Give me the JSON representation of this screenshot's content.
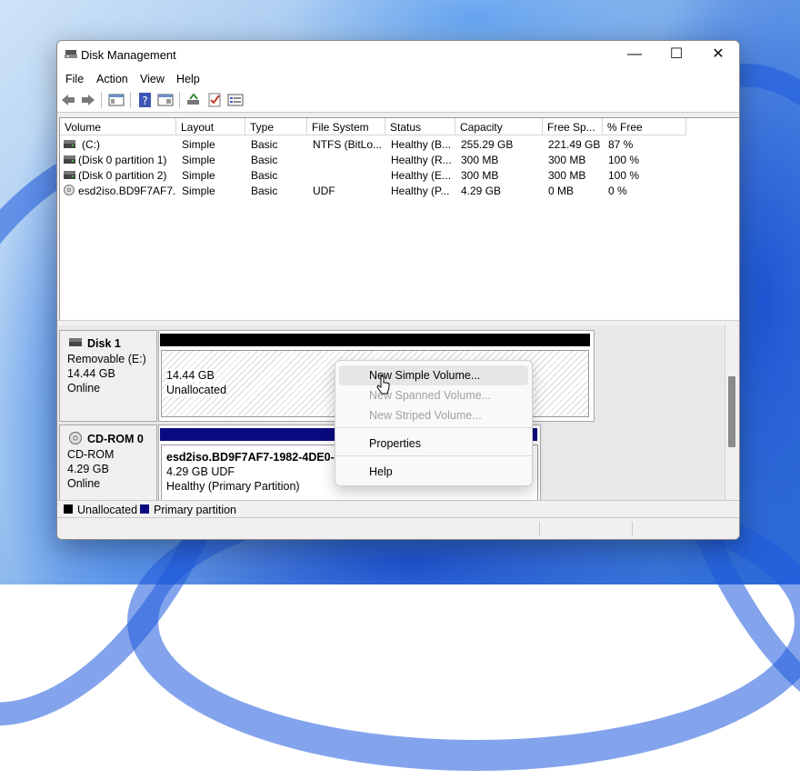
{
  "window": {
    "title": "Disk Management",
    "controls": {
      "minimize": "—",
      "maximize": "☐",
      "close": "✕"
    }
  },
  "menu": [
    "File",
    "Action",
    "View",
    "Help"
  ],
  "toolbar_icons": [
    "back-arrow-icon",
    "forward-arrow-icon",
    "console-tree-icon",
    "help-icon",
    "properties-icon",
    "connect-icon",
    "check-icon",
    "list-icon"
  ],
  "volume_list": {
    "columns": [
      "Volume",
      "Layout",
      "Type",
      "File System",
      "Status",
      "Capacity",
      "Free Sp...",
      "% Free"
    ],
    "rows": [
      {
        "volume": "(C:)",
        "layout": "Simple",
        "type": "Basic",
        "file_system": "NTFS (BitLo...",
        "status": "Healthy (B...",
        "capacity": "255.29 GB",
        "free": "221.49 GB",
        "pct_free": "87 %",
        "icon": "drive-icon"
      },
      {
        "volume": "(Disk 0 partition 1)",
        "layout": "Simple",
        "type": "Basic",
        "file_system": "",
        "status": "Healthy (R...",
        "capacity": "300 MB",
        "free": "300 MB",
        "pct_free": "100 %",
        "icon": "drive-icon"
      },
      {
        "volume": "(Disk 0 partition 2)",
        "layout": "Simple",
        "type": "Basic",
        "file_system": "",
        "status": "Healthy (E...",
        "capacity": "300 MB",
        "free": "300 MB",
        "pct_free": "100 %",
        "icon": "drive-icon"
      },
      {
        "volume": "esd2iso.BD9F7AF7...",
        "layout": "Simple",
        "type": "Basic",
        "file_system": "UDF",
        "status": "Healthy (P...",
        "capacity": "4.29 GB",
        "free": "0 MB",
        "pct_free": "0 %",
        "icon": "disc-icon"
      }
    ]
  },
  "disks": [
    {
      "name": "Disk 1",
      "kind": "Removable (E:)",
      "size": "14.44 GB",
      "state": "Online",
      "partition": {
        "line1": "14.44 GB",
        "line2": "Unallocated"
      }
    },
    {
      "name": "CD-ROM 0",
      "kind": "CD-ROM",
      "size": "4.29 GB",
      "state": "Online",
      "partition": {
        "line1": "esd2iso.BD9F7AF7-1982-4DE0-87",
        "line2": "4.29 GB UDF",
        "line3": "Healthy (Primary Partition)"
      }
    }
  ],
  "legend": [
    {
      "label": "Unallocated",
      "color": "#000000"
    },
    {
      "label": "Primary partition",
      "color": "#0a0a80"
    }
  ],
  "context_menu": {
    "items": [
      {
        "label": "New Simple Volume...",
        "enabled": true,
        "hover": true
      },
      {
        "label": "New Spanned Volume...",
        "enabled": false
      },
      {
        "label": "New Striped Volume...",
        "enabled": false
      },
      {
        "label": "Properties",
        "enabled": true
      },
      {
        "label": "Help",
        "enabled": true
      }
    ]
  }
}
